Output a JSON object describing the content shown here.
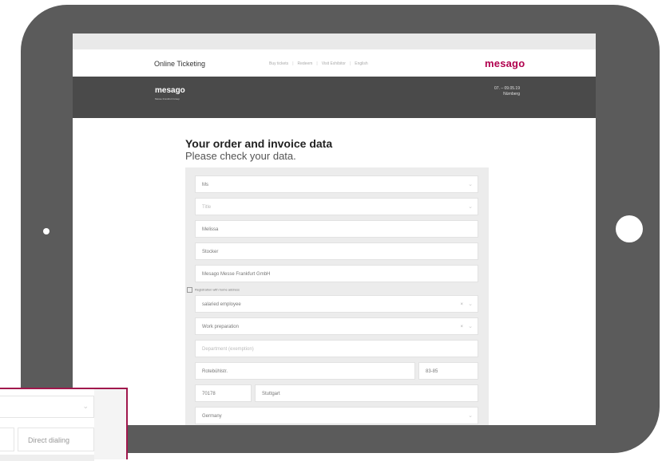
{
  "header": {
    "title": "Online Ticketing",
    "nav": [
      "Buy tickets",
      "Redeem",
      "Visit Exhibitor"
    ],
    "language": "English",
    "logo": "mesago"
  },
  "banner": {
    "logo": "mesago",
    "tagline": "Messe Frankfurt Group",
    "date": "07. – 09.05.19",
    "place": "Nürnberg"
  },
  "page": {
    "heading": "Your order and invoice data",
    "subheading": "Please check your data."
  },
  "form": {
    "salutation": "Ms",
    "title_placeholder": "Title",
    "first_name": "Melissa",
    "last_name": "Stocker",
    "company": "Mesago Messe Frankfurt GmbH",
    "checkbox_label": "Registration with home address",
    "position": "salaried employee",
    "department": "Work preparation",
    "department_placeholder": "Department (exemption)",
    "street": "Rotebühlstr.",
    "house_number": "83-85",
    "zip": "70178",
    "city": "Stuttgart",
    "country": "Germany"
  },
  "inset": {
    "direct_dialing_placeholder": "Direct dialing"
  },
  "colors": {
    "accent": "#b0004e",
    "tablet": "#5b5b5b",
    "banner": "#4a4a4a"
  }
}
